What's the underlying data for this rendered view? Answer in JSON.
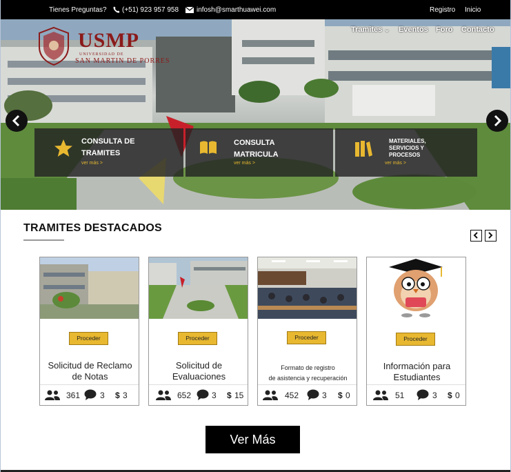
{
  "topbar": {
    "question": "Tienes Preguntas?",
    "phone": "(+51) 923 957 958",
    "email": "infosh@smarthuawei.com",
    "register": "Registro",
    "home": "Inicio"
  },
  "nav": {
    "items": [
      {
        "label": "Tramites"
      },
      {
        "label": "Eventos"
      },
      {
        "label": "Foro"
      },
      {
        "label": "Contacto"
      }
    ]
  },
  "logo": {
    "name": "USMP",
    "sub1": "UNIVERSIDAD DE",
    "sub2": "SAN MARTIN DE PORRES"
  },
  "quick_links": [
    {
      "title_1": "CONSULTA DE",
      "title_2": "TRAMITES",
      "more": "ver más >",
      "icon": "star-icon"
    },
    {
      "title_1": "CONSULTA",
      "title_2": "MATRICULA",
      "more": "ver más >",
      "icon": "book-icon"
    },
    {
      "title_1": "MATERIALES,",
      "title_2": "SERVICIOS Y",
      "title_3": "PROCESOS",
      "more": "ver más >",
      "icon": "books-icon"
    }
  ],
  "section": {
    "title": "TRAMITES DESTACADOS"
  },
  "cards": [
    {
      "button": "Proceder",
      "name_1": "Solicitud de Reclamo",
      "name_2": "de Notas",
      "users": "361",
      "comments": "3",
      "price": "3"
    },
    {
      "button": "Proceder",
      "name_1": "Solicitud de",
      "name_2": "Evaluaciones",
      "users": "652",
      "comments": "3",
      "price": "15"
    },
    {
      "button": "Proceder",
      "name_1": "Formato de registro",
      "name_2": "de asistencia y recuperación",
      "users": "452",
      "comments": "3",
      "price": "0"
    },
    {
      "button": "Proceder",
      "name_1": "Información para",
      "name_2": "Estudiantes",
      "users": "51",
      "comments": "3",
      "price": "0"
    }
  ],
  "cta": {
    "label": "Ver Más"
  },
  "colors": {
    "accent": "#e8b830",
    "brand": "#8b1a1a",
    "dark": "#000000"
  }
}
